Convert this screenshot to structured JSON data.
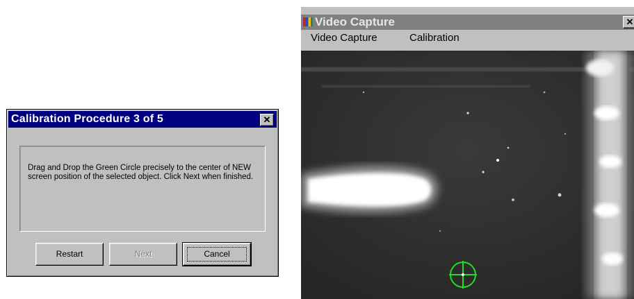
{
  "dialog": {
    "title": "Calibration Procedure 3 of 5",
    "message": "Drag and Drop the Green Circle precisely to the center of NEW screen position of the selected object. Click Next when finished.",
    "buttons": {
      "restart": "Restart",
      "next": "Next",
      "cancel": "Cancel"
    },
    "close_glyph": "✕"
  },
  "video_window": {
    "title": "Video Capture",
    "close_glyph": "✕",
    "menu": [
      "Video Capture",
      "Calibration"
    ],
    "target_color": "#22dd22"
  }
}
